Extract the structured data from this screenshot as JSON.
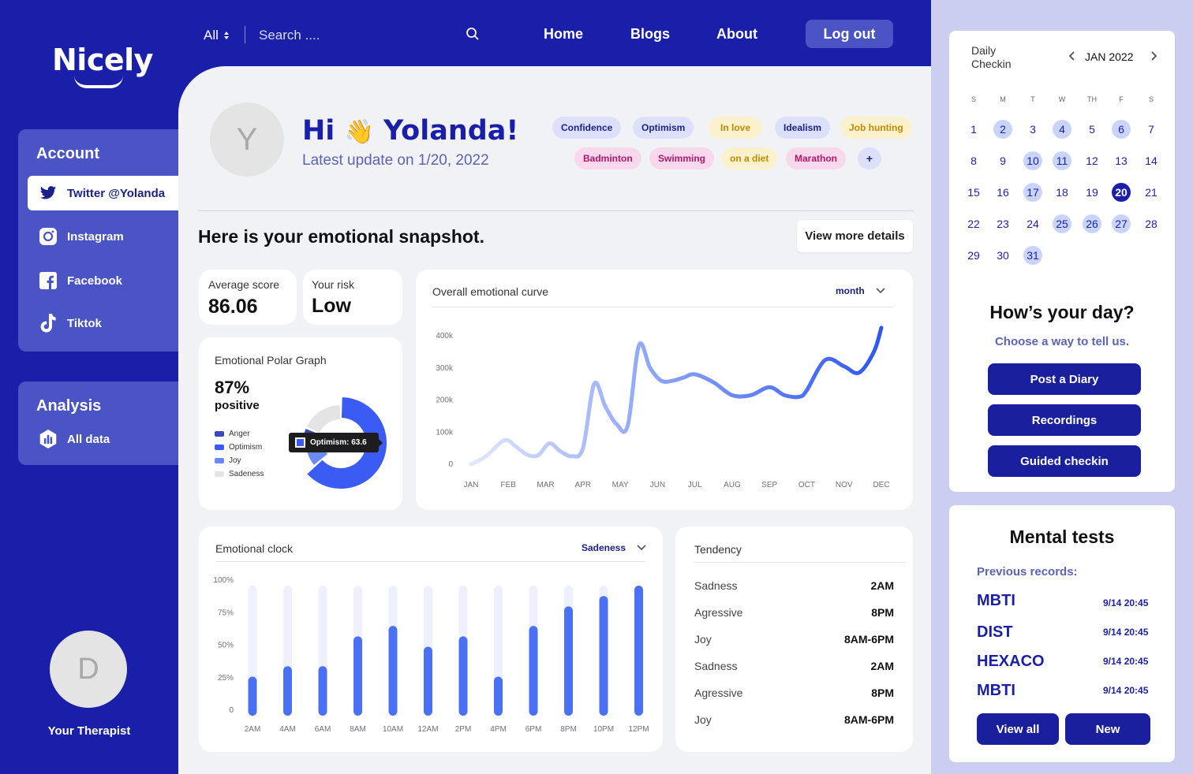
{
  "brand": {
    "name": "Nicely"
  },
  "sidebar": {
    "account_title": "Account",
    "accounts": [
      {
        "label": "Twitter @Yolanda",
        "icon": "twitter-icon",
        "active": true
      },
      {
        "label": "Instagram",
        "icon": "instagram-icon",
        "active": false
      },
      {
        "label": "Facebook",
        "icon": "facebook-icon",
        "active": false
      },
      {
        "label": "Tiktok",
        "icon": "tiktok-icon",
        "active": false
      }
    ],
    "analysis_title": "Analysis",
    "analysis_items": [
      {
        "label": "All data",
        "icon": "hexagon-chart-icon"
      }
    ],
    "therapist": {
      "initial": "D",
      "label": "Your Therapist"
    }
  },
  "topbar": {
    "filter": "All",
    "search_placeholder": "Search ....",
    "nav": [
      "Home",
      "Blogs",
      "About"
    ],
    "logout": "Log out"
  },
  "profile": {
    "initial": "Y",
    "greeting_prefix": "Hi",
    "greeting_emoji": "👋",
    "greeting_name": "Yolanda!",
    "update_text": "Latest update on 1/20, 2022",
    "tags": [
      {
        "label": "Confidence",
        "style": "blue"
      },
      {
        "label": "Optimism",
        "style": "blue"
      },
      {
        "label": "In love",
        "style": "yellow"
      },
      {
        "label": "Idealism",
        "style": "blue"
      },
      {
        "label": "Job hunting",
        "style": "yellow"
      },
      {
        "label": "Badminton",
        "style": "pink"
      },
      {
        "label": "Swimming",
        "style": "pink"
      },
      {
        "label": "on a diet",
        "style": "yellow"
      },
      {
        "label": "Marathon",
        "style": "pink"
      },
      {
        "label": "+",
        "style": "blue"
      }
    ]
  },
  "snapshot": {
    "title": "Here is your emotional snapshot.",
    "more_button": "View more details",
    "average_score": {
      "label": "Average score",
      "value": "86.06"
    },
    "risk": {
      "label": "Your risk",
      "value": "Low"
    }
  },
  "polar": {
    "title": "Emotional Polar Graph",
    "percent": "87%",
    "percent_label": "positive",
    "tooltip": "Optimism: 63.6",
    "legend": [
      {
        "label": "Anger",
        "color": "#3a48b8"
      },
      {
        "label": "Optimism",
        "color": "#3a5cf5"
      },
      {
        "label": "Joy",
        "color": "#6a8af5"
      },
      {
        "label": "Sadeness",
        "color": "#e4e4e4"
      }
    ]
  },
  "curve": {
    "title": "Overall emotional curve",
    "dropdown": "month"
  },
  "clock": {
    "title": "Emotional clock",
    "dropdown": "Sadeness"
  },
  "tendency": {
    "title": "Tendency",
    "rows": [
      {
        "name": "Sadness",
        "time": "2AM"
      },
      {
        "name": "Agressive",
        "time": "8PM"
      },
      {
        "name": "Joy",
        "time": "8AM-6PM"
      },
      {
        "name": "Sadness",
        "time": "2AM"
      },
      {
        "name": "Agressive",
        "time": "8PM"
      },
      {
        "name": "Joy",
        "time": "8AM-6PM"
      }
    ]
  },
  "calendar": {
    "title_line1": "Daily",
    "title_line2": "Checkin",
    "month": "JAN 2022",
    "dow": [
      "S",
      "M",
      "T",
      "W",
      "TH",
      "F",
      "S"
    ],
    "days_in_month": 31,
    "first_weekday": 0,
    "checked_days": [
      2,
      4,
      6,
      10,
      11,
      17,
      25,
      26,
      27,
      31
    ],
    "today": 20
  },
  "day": {
    "title": "How’s your day?",
    "subtitle": "Choose a way to tell us.",
    "buttons": [
      "Post a Diary",
      "Recordings",
      "Guided checkin"
    ]
  },
  "tests": {
    "title": "Mental tests",
    "subtitle": "Previous records:",
    "records": [
      {
        "name": "MBTI",
        "date": "9/14 20:45"
      },
      {
        "name": "DIST",
        "date": "9/14 20:45"
      },
      {
        "name": "HEXACO",
        "date": "9/14 20:45"
      },
      {
        "name": "MBTI",
        "date": "9/14 20:45"
      }
    ],
    "view_all": "View all",
    "new": "New"
  },
  "colors": {
    "brand": "#1a1faa",
    "accent": "#3a5cf5",
    "panel": "#4a54c4",
    "right_bg": "#cbcdf1"
  },
  "chart_data": [
    {
      "type": "area",
      "title": "Overall emotional curve",
      "categories": [
        "JAN",
        "FEB",
        "MAR",
        "APR",
        "MAY",
        "JUN",
        "JUL",
        "AUG",
        "SEP",
        "OCT",
        "NOV",
        "DEC"
      ],
      "y_ticks": [
        "0",
        "100k",
        "200k",
        "300k",
        "400k"
      ],
      "ylim": [
        0,
        400000
      ],
      "x": [
        0,
        0.4,
        0.9,
        1.2,
        1.5,
        1.8,
        2.1,
        2.4,
        2.7,
        3.0,
        3.3,
        3.6,
        3.9,
        4.2,
        4.5,
        4.8,
        5.1,
        5.4,
        5.7,
        6.0,
        6.5,
        7.0,
        7.5,
        8.0,
        8.4,
        8.8,
        9.0,
        9.5,
        10.0,
        10.4,
        10.8,
        11.0
      ],
      "values": [
        0,
        25000,
        75000,
        55000,
        30000,
        28000,
        65000,
        40000,
        25000,
        50000,
        250000,
        180000,
        125000,
        120000,
        370000,
        300000,
        260000,
        260000,
        270000,
        280000,
        255000,
        215000,
        215000,
        240000,
        215000,
        210000,
        230000,
        325000,
        305000,
        285000,
        350000,
        425000
      ],
      "grid": false
    },
    {
      "type": "bar",
      "title": "Emotional clock",
      "categories": [
        "2AM",
        "4AM",
        "6AM",
        "8AM",
        "10AM",
        "12AM",
        "2PM",
        "4PM",
        "6PM",
        "8PM",
        "10PM",
        "12PM"
      ],
      "values": [
        30,
        38,
        38,
        61,
        69,
        53,
        61,
        30,
        69,
        84,
        92,
        100
      ],
      "max": 100,
      "y_ticks": [
        "0",
        "25%",
        "50%",
        "75%",
        "100%"
      ]
    },
    {
      "type": "pie",
      "title": "Emotional Polar Graph",
      "categories": [
        "Anger",
        "Optimism",
        "Joy",
        "Sadeness"
      ],
      "values": [
        8,
        63.6,
        10,
        18.4
      ]
    }
  ]
}
